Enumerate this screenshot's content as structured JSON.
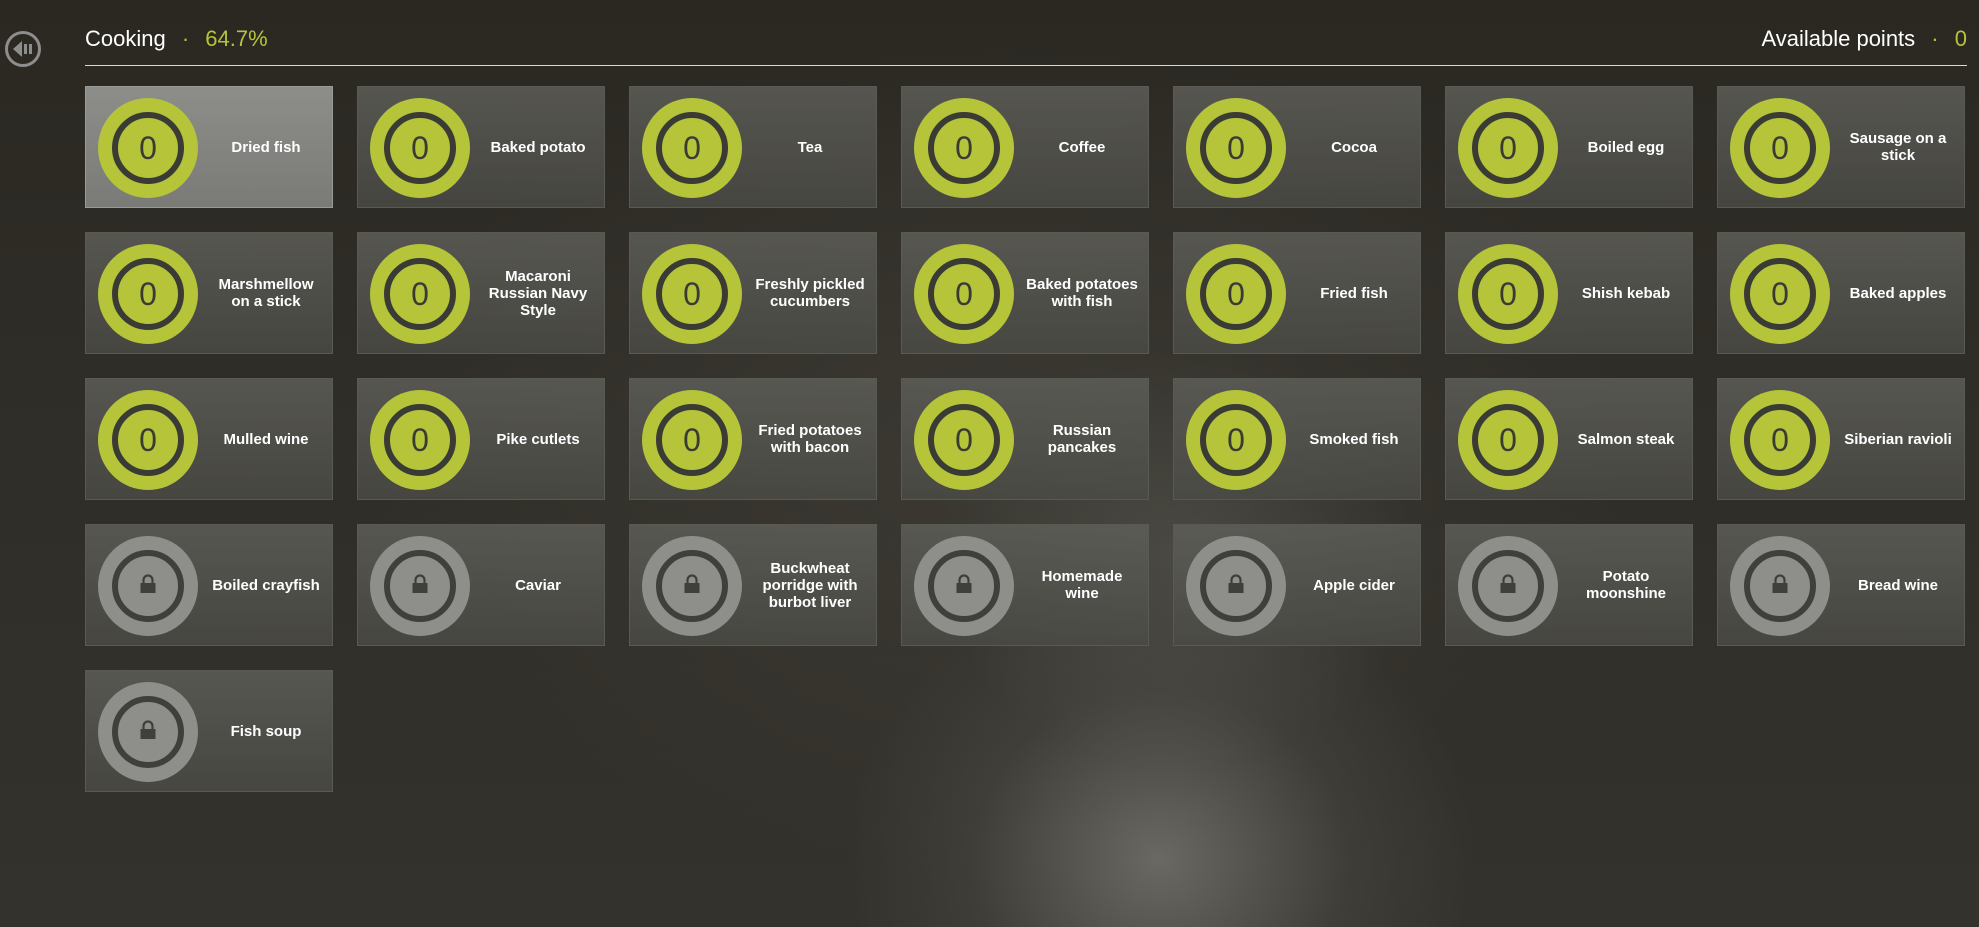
{
  "header": {
    "title": "Cooking",
    "separator": "·",
    "progress": "64.7%",
    "points_label": "Available points",
    "points_value": "0"
  },
  "colors": {
    "accent": "#b6c43a",
    "locked": "#8e8e8b"
  },
  "icons": {
    "back": "back-arrow-icon",
    "lock": "lock-icon"
  },
  "skills": [
    {
      "label": "Dried fish",
      "level": "0",
      "locked": false,
      "selected": true
    },
    {
      "label": "Baked potato",
      "level": "0",
      "locked": false
    },
    {
      "label": "Tea",
      "level": "0",
      "locked": false
    },
    {
      "label": "Coffee",
      "level": "0",
      "locked": false
    },
    {
      "label": "Cocoa",
      "level": "0",
      "locked": false
    },
    {
      "label": "Boiled egg",
      "level": "0",
      "locked": false
    },
    {
      "label": "Sausage on a stick",
      "level": "0",
      "locked": false
    },
    {
      "label": "Marshmellow on a stick",
      "level": "0",
      "locked": false
    },
    {
      "label": "Macaroni Russian Navy Style",
      "level": "0",
      "locked": false
    },
    {
      "label": "Freshly pickled cucumbers",
      "level": "0",
      "locked": false
    },
    {
      "label": "Baked potatoes with fish",
      "level": "0",
      "locked": false
    },
    {
      "label": "Fried fish",
      "level": "0",
      "locked": false
    },
    {
      "label": "Shish kebab",
      "level": "0",
      "locked": false
    },
    {
      "label": "Baked apples",
      "level": "0",
      "locked": false
    },
    {
      "label": "Mulled wine",
      "level": "0",
      "locked": false
    },
    {
      "label": "Pike cutlets",
      "level": "0",
      "locked": false
    },
    {
      "label": "Fried potatoes with bacon",
      "level": "0",
      "locked": false
    },
    {
      "label": "Russian pancakes",
      "level": "0",
      "locked": false
    },
    {
      "label": "Smoked fish",
      "level": "0",
      "locked": false
    },
    {
      "label": "Salmon steak",
      "level": "0",
      "locked": false
    },
    {
      "label": "Siberian ravioli",
      "level": "0",
      "locked": false
    },
    {
      "label": "Boiled crayfish",
      "locked": true
    },
    {
      "label": "Caviar",
      "locked": true
    },
    {
      "label": "Buckwheat porridge with burbot liver",
      "locked": true
    },
    {
      "label": "Homemade wine",
      "locked": true
    },
    {
      "label": "Apple cider",
      "locked": true
    },
    {
      "label": "Potato moonshine",
      "locked": true
    },
    {
      "label": "Bread wine",
      "locked": true
    },
    {
      "label": "Fish soup",
      "locked": true
    }
  ]
}
